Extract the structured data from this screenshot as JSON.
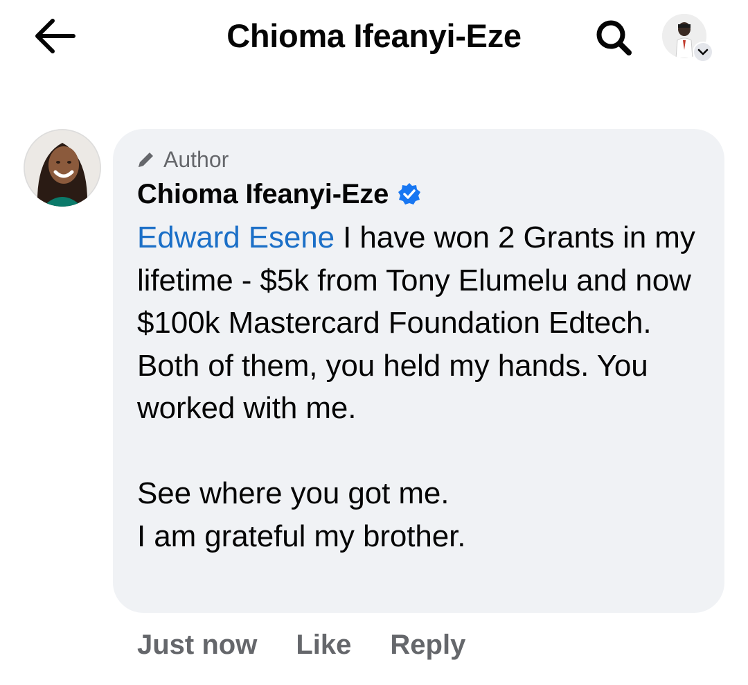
{
  "header": {
    "title": "Chioma Ifeanyi-Eze",
    "back_icon": "arrow-left-icon",
    "search_icon": "search-icon",
    "profile_icon": "profile-avatar"
  },
  "comment": {
    "badge": "Author",
    "badge_icon": "pencil-icon",
    "author": "Chioma Ifeanyi-Eze",
    "verified_icon": "verified-badge-icon",
    "mention": "Edward Esene",
    "text_first": " I have won 2 Grants in my lifetime - $5k from Tony Elumelu and now $100k Mastercard Foundation Edtech. Both of them, you held my hands. You worked with me.",
    "line_see": "See where you got me.",
    "line_grateful": "I am grateful my brother.",
    "timestamp": "Just now",
    "like_label": "Like",
    "reply_label": "Reply"
  },
  "colors": {
    "mention": "#1b6fc7",
    "verified": "#1877f2",
    "bubble": "#f0f2f5",
    "meta": "#65676b"
  }
}
